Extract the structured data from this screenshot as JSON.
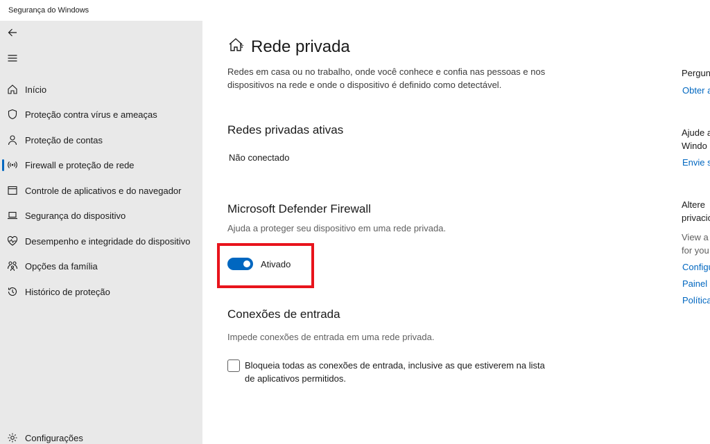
{
  "window": {
    "title": "Segurança do Windows"
  },
  "sidebar": {
    "back_icon": "back-arrow-icon",
    "menu_icon": "hamburger-menu-icon",
    "items": [
      {
        "label": "Início",
        "icon": "home-icon"
      },
      {
        "label": "Proteção contra vírus e ameaças",
        "icon": "shield-icon"
      },
      {
        "label": "Proteção de contas",
        "icon": "person-icon"
      },
      {
        "label": "Firewall e proteção de rede",
        "icon": "antenna-icon",
        "active": true
      },
      {
        "label": "Controle de aplicativos e do navegador",
        "icon": "app-browser-icon"
      },
      {
        "label": "Segurança do dispositivo",
        "icon": "laptop-icon"
      },
      {
        "label": "Desempenho e integridade do dispositivo",
        "icon": "heart-pulse-icon"
      },
      {
        "label": "Opções da família",
        "icon": "family-icon"
      },
      {
        "label": "Histórico de proteção",
        "icon": "history-icon"
      }
    ],
    "settings": {
      "label": "Configurações",
      "icon": "gear-icon"
    }
  },
  "main": {
    "title": "Rede privada",
    "title_icon": "private-network-house-icon",
    "description": "Redes em casa ou no trabalho, onde você conhece e confia nas pessoas e nos dispositivos na rede e onde o dispositivo é definido como detectável.",
    "active_networks": {
      "heading": "Redes privadas ativas",
      "value": "Não conectado"
    },
    "firewall": {
      "heading": "Microsoft Defender Firewall",
      "subtitle": "Ajuda a proteger seu dispositivo em uma rede privada.",
      "toggle_label": "Ativado",
      "toggle_on": true,
      "accent_color": "#0067c0",
      "highlight_color": "#e8141c"
    },
    "incoming": {
      "heading": "Conexões de entrada",
      "subtitle": "Impede conexões de entrada em uma rede privada.",
      "checkbox_label": "Bloqueia todas as conexões de entrada, inclusive as que estiverem na lista de aplicativos permitidos.",
      "checked": false
    }
  },
  "right_panel": {
    "question_heading": "Pergun",
    "question_link": "Obter a",
    "help_heading_line1": "Ajude a",
    "help_heading_line2": "Windo",
    "help_link": "Envie s",
    "change_heading_line1": "Altere",
    "change_heading_line2": "privacio",
    "view_line1": "View a",
    "view_line2": "for you",
    "links": [
      "Configu",
      "Painel d",
      "Política"
    ]
  }
}
